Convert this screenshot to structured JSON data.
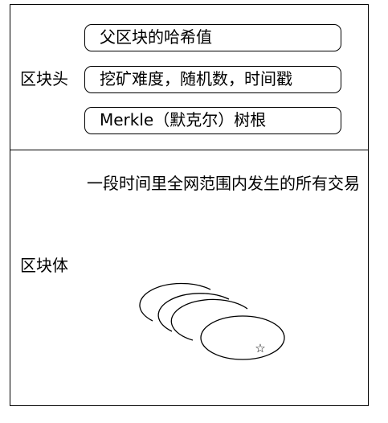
{
  "block_header": {
    "label": "区块头",
    "fields": [
      "父区块的哈希值",
      "挖矿难度，随机数，时间戳",
      "Merkle（默克尔）树根"
    ]
  },
  "block_body": {
    "label": "区块体",
    "description": "一段时间里全网范围内发生的所有交易",
    "transaction_marker": "☆"
  }
}
